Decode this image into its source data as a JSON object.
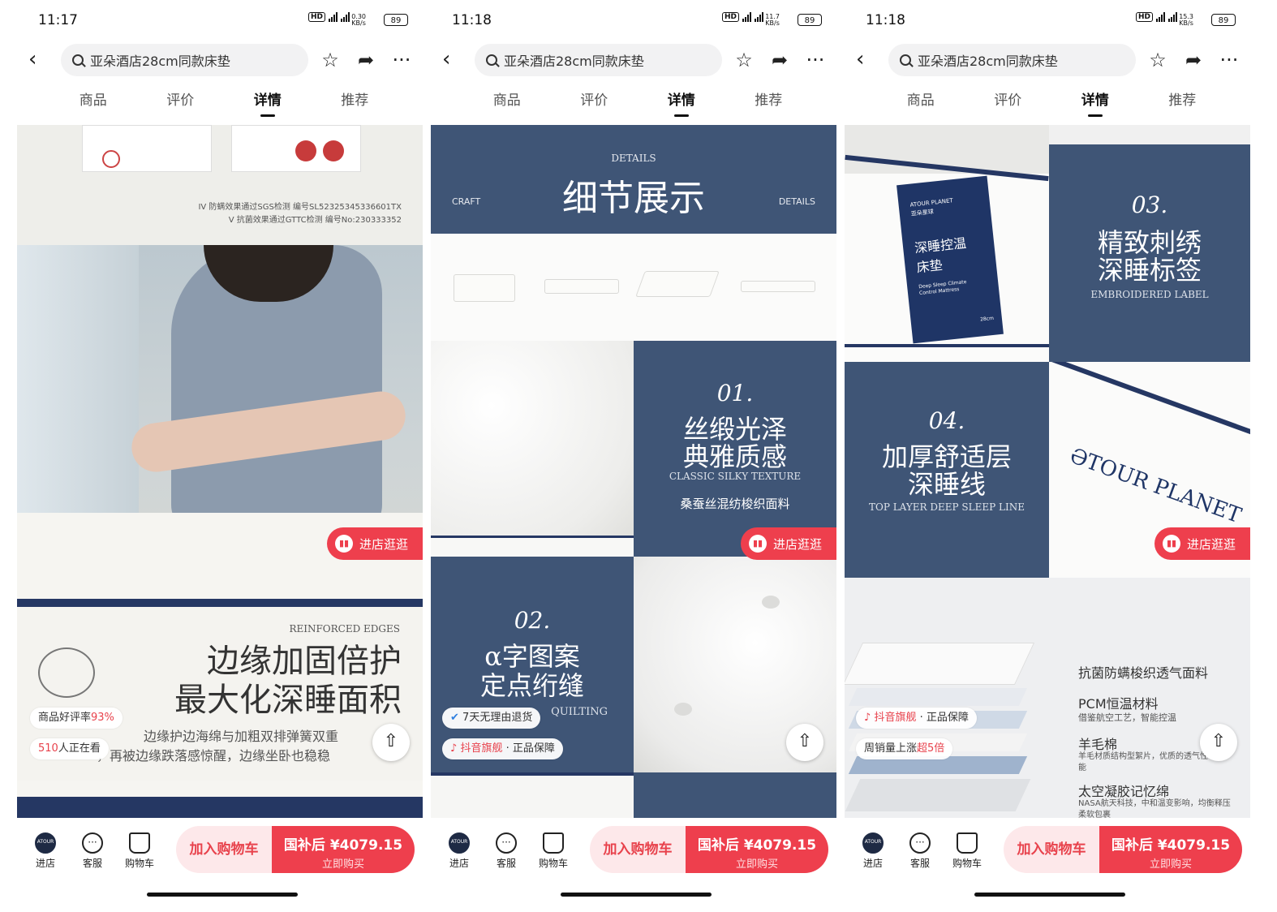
{
  "phones": [
    {
      "time": "11:17",
      "net_speed": "0.30",
      "net_unit": "KB/s",
      "battery": "89",
      "search_text": "亚朵酒店28cm同款床垫",
      "tabs": [
        "商品",
        "评价",
        "详情",
        "推荐"
      ],
      "active_tab": "详情",
      "content": {
        "cert_line1": "IV 防螨效果通过SGS检测  编号SL52325345336601TX",
        "cert_line2": "V 抗菌效果通过GTTC检测  编号No:230333352",
        "edge_en": "REINFORCED EDGES",
        "edge_title1": "边缘加固倍护",
        "edge_title2": "最大化深睡面积",
        "edge_desc1": "边缘护边海绵与加粗双排弹簧双重",
        "edge_desc2": "，再被边缘跌落感惊醒，边缘坐卧也稳稳",
        "rating_label": "商品好评率",
        "rating_value": "93%",
        "viewers_count": "510",
        "viewers_label": "人正在看",
        "shop_button": "进店逛逛"
      },
      "bottom": {
        "store": "进店",
        "service": "客服",
        "cart": "购物车",
        "add_cart": "加入购物车",
        "price": "国补后 ¥4079.15",
        "buy_now": "立即购买"
      }
    },
    {
      "time": "11:18",
      "net_speed": "11.7",
      "net_unit": "KB/s",
      "battery": "89",
      "search_text": "亚朵酒店28cm同款床垫",
      "tabs": [
        "商品",
        "评价",
        "详情",
        "推荐"
      ],
      "active_tab": "详情",
      "content": {
        "banner_top": "DETAILS",
        "banner_title": "细节展示",
        "banner_left": "CRAFT",
        "banner_right": "DETAILS",
        "d1_num": "01.",
        "d1_title1": "丝缎光泽",
        "d1_title2": "典雅质感",
        "d1_en": "CLASSIC SILKY TEXTURE",
        "d1_desc": "桑蚕丝混纺梭织面料",
        "d2_num": "02.",
        "d2_title1": "α字图案",
        "d2_title2": "定点绗缝",
        "d2_en": "QUILTING",
        "badge_return": "7天无理由退货",
        "badge_flagship": "抖音旗舰",
        "badge_guarantee": "· 正品保障",
        "shop_button": "进店逛逛"
      },
      "bottom": {
        "store": "进店",
        "service": "客服",
        "cart": "购物车",
        "add_cart": "加入购物车",
        "price": "国补后 ¥4079.15",
        "buy_now": "立即购买"
      }
    },
    {
      "time": "11:18",
      "net_speed": "15.3",
      "net_unit": "KB/s",
      "battery": "89",
      "search_text": "亚朵酒店28cm同款床垫",
      "tabs": [
        "商品",
        "评价",
        "详情",
        "推荐"
      ],
      "active_tab": "详情",
      "content": {
        "label_brand": "ATOUR PLANET",
        "label_brand_cn": "亚朵星球",
        "label_cn1": "深睡控温",
        "label_cn2": "床垫",
        "label_en": "Deep Sleep Climate Control Mattress",
        "label_size": "28cm",
        "d3_num": "03.",
        "d3_title1": "精致刺绣",
        "d3_title2": "深睡标签",
        "d3_en": "EMBROIDERED LABEL",
        "d4_num": "04.",
        "d4_title1": "加厚舒适层",
        "d4_title2": "深睡线",
        "d4_en": "TOP LAYER DEEP SLEEP LINE",
        "logo_text": "ƏTOUR PLANET",
        "layer1": "抗菌防螨梭织透气面料",
        "layer2": "PCM恒温材料",
        "layer2_desc": "借鉴航空工艺，智能控温",
        "layer3": "羊毛棉",
        "layer3_desc": "羊毛材质结构型絮片，优质的透气性能",
        "layer4": "太空凝胶记忆绵",
        "layer4_desc": "NASA航天科技，中和温变影响，均衡释压柔软包裹",
        "badge_flagship": "抖音旗舰",
        "badge_guarantee": "· 正品保障",
        "sales_label": "周销量上涨",
        "sales_value": "超5倍",
        "shop_button": "进店逛逛"
      },
      "bottom": {
        "store": "进店",
        "service": "客服",
        "cart": "购物车",
        "add_cart": "加入购物车",
        "price": "国补后 ¥4079.15",
        "buy_now": "立即购买"
      }
    }
  ],
  "colors": {
    "accent_red": "#ee3f4d",
    "navy_panel": "#3f5576",
    "mattress_white": "#f7f7f5"
  },
  "icons": [
    "back-icon",
    "search-icon",
    "star-icon",
    "share-icon",
    "more-icon",
    "store-icon",
    "service-icon",
    "cart-icon",
    "scroll-top-icon"
  ]
}
